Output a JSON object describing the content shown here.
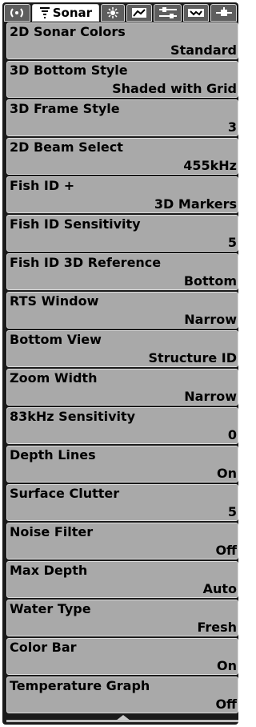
{
  "tabs": {
    "active_label": "Sonar",
    "items": [
      {
        "icon": "radio-icon"
      },
      {
        "icon": "sonar-icon",
        "label": "Sonar"
      },
      {
        "icon": "navigation-icon"
      },
      {
        "icon": "chart-map-icon"
      },
      {
        "icon": "sliders-icon"
      },
      {
        "icon": "accessories-icon"
      },
      {
        "icon": "network-icon"
      }
    ]
  },
  "menu": {
    "items": [
      {
        "label": "2D Sonar Colors",
        "value": "Standard"
      },
      {
        "label": "3D Bottom Style",
        "value": "Shaded with Grid"
      },
      {
        "label": "3D Frame Style",
        "value": "3"
      },
      {
        "label": "2D Beam Select",
        "value": "455kHz"
      },
      {
        "label": "Fish ID +",
        "value": "3D Markers"
      },
      {
        "label": "Fish ID Sensitivity",
        "value": "5"
      },
      {
        "label": "Fish ID 3D Reference",
        "value": "Bottom"
      },
      {
        "label": "RTS Window",
        "value": "Narrow"
      },
      {
        "label": "Bottom View",
        "value": "Structure ID"
      },
      {
        "label": "Zoom Width",
        "value": "Narrow"
      },
      {
        "label": "83kHz Sensitivity",
        "value": "0"
      },
      {
        "label": "Depth Lines",
        "value": "On"
      },
      {
        "label": "Surface Clutter",
        "value": "5"
      },
      {
        "label": "Noise Filter",
        "value": "Off"
      },
      {
        "label": "Max Depth",
        "value": "Auto"
      },
      {
        "label": "Water Type",
        "value": "Fresh"
      },
      {
        "label": "Color Bar",
        "value": "On"
      },
      {
        "label": "Temperature Graph",
        "value": "Off"
      }
    ]
  },
  "colors": {
    "item_bg": "#a9a9a9",
    "tab_bg": "#5e5e5e",
    "frame": "#1a1a1a"
  }
}
